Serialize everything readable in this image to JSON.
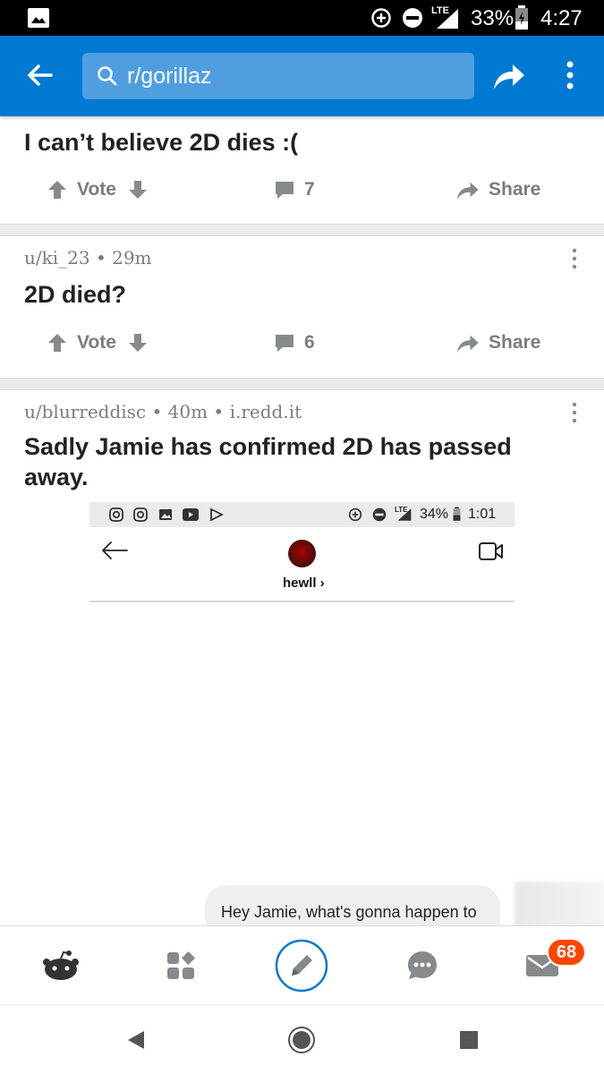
{
  "status_bar": {
    "battery": "33%",
    "network": "LTE",
    "time": "4:27"
  },
  "app_bar": {
    "search_text": "r/gorillaz",
    "icons": [
      "back-arrow-icon",
      "search-icon",
      "share-icon",
      "more-vertical-icon"
    ]
  },
  "posts": [
    {
      "title": "I can’t believe 2D dies :(",
      "vote_label": "Vote",
      "comments": "7",
      "share_label": "Share"
    },
    {
      "author": "u/ki_23",
      "age": "29m",
      "title": "2D died?",
      "vote_label": "Vote",
      "comments": "6",
      "share_label": "Share"
    },
    {
      "author": "u/blurreddisc",
      "age": "40m",
      "domain": "i.redd.it",
      "title": "Sadly Jamie has confirmed 2D has passed away.",
      "embed": {
        "status_battery": "34%",
        "status_time": "1:01",
        "status_network": "LTE",
        "username": "hewll ›",
        "message": "Hey Jamie, what's gonna happen to"
      }
    }
  ],
  "separator": "•",
  "bottom_nav": {
    "items": [
      "home-icon",
      "communities-icon",
      "create-post-icon",
      "chat-icon",
      "inbox-icon"
    ],
    "inbox_badge": "68"
  },
  "system_nav": [
    "back-triangle-icon",
    "home-circle-icon",
    "recents-square-icon"
  ],
  "colors": {
    "brand_blue": "#0079d3",
    "badge_orange": "#ff4500",
    "meta_gray": "#7c7c7c"
  }
}
